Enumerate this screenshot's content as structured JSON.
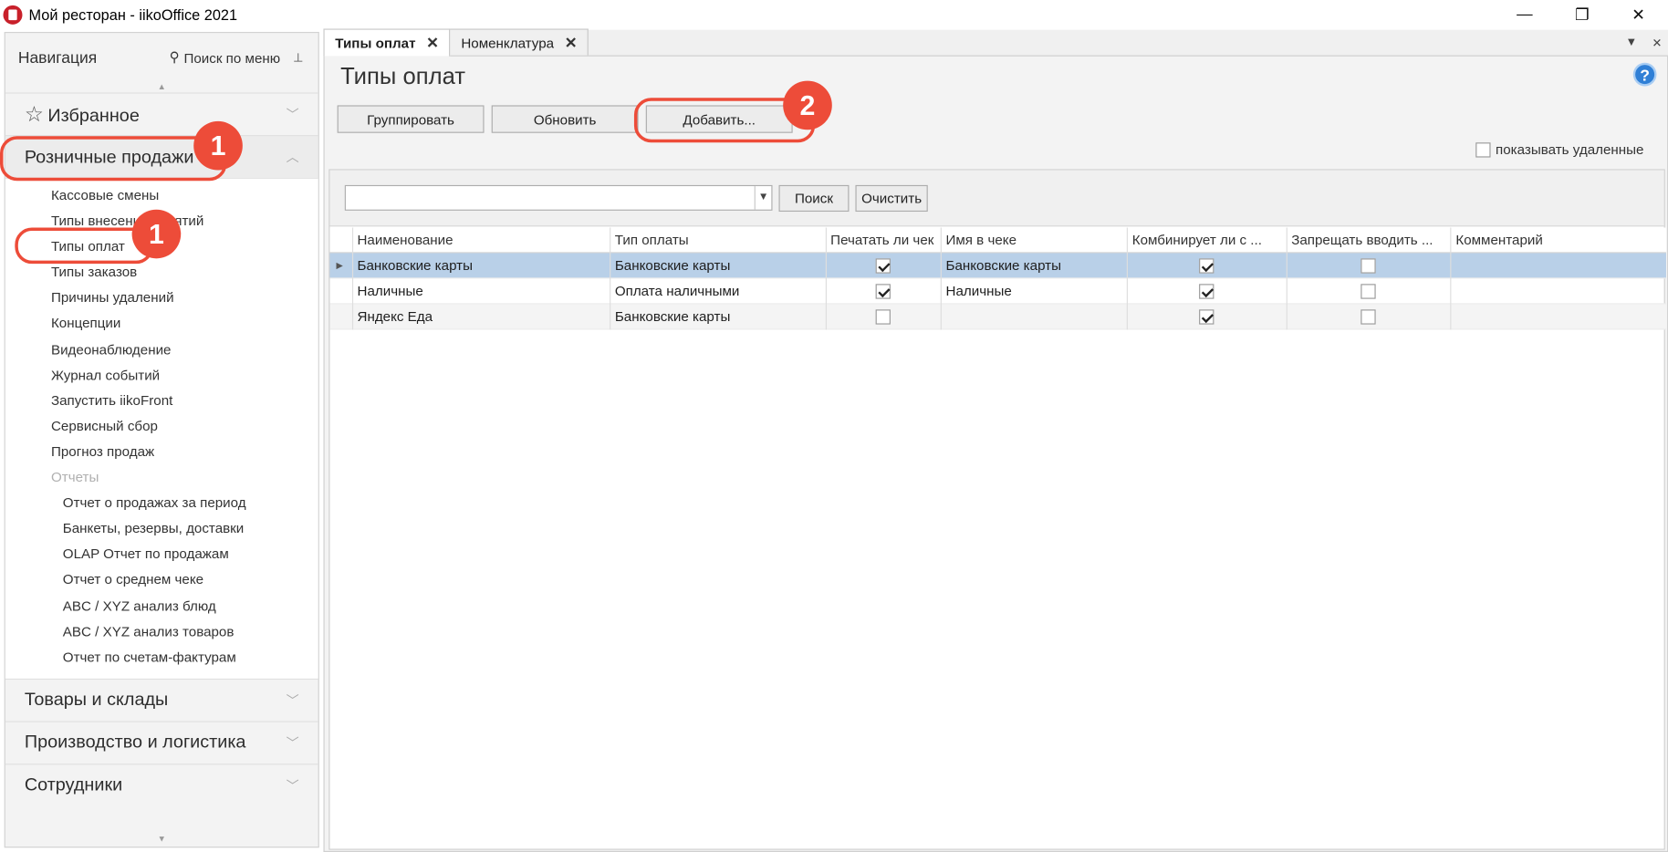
{
  "window": {
    "title": "Мой ресторан - iikoOffice 2021",
    "minimize": "—",
    "restore": "❐",
    "close": "✕"
  },
  "sidebar": {
    "header": "Навигация",
    "search_label": "Поиск по меню",
    "groups_top": [
      {
        "label": "Избранное"
      },
      {
        "label": "Розничные продажи"
      }
    ],
    "items": [
      "Кассовые смены",
      "Типы внесений/изъятий",
      "Типы оплат",
      "Типы заказов",
      "Причины удалений",
      "Концепции",
      "Видеонаблюдение",
      "Журнал событий",
      "Запустить iikoFront",
      "Сервисный сбор",
      "Прогноз продаж"
    ],
    "reports_label": "Отчеты",
    "reports": [
      "Отчет о продажах за период",
      "Банкеты, резервы, доставки",
      "OLAP Отчет по продажам",
      "Отчет о среднем чеке",
      "ABC / XYZ анализ блюд",
      "ABC / XYZ анализ товаров",
      "Отчет по счетам-фактурам"
    ],
    "groups_bottom": [
      {
        "label": "Товары и склады"
      },
      {
        "label": "Производство и логистика"
      },
      {
        "label": "Сотрудники"
      }
    ]
  },
  "tabs": [
    {
      "label": "Типы оплат",
      "active": true
    },
    {
      "label": "Номенклатура",
      "active": false
    }
  ],
  "page": {
    "title": "Типы оплат",
    "help": "?",
    "buttons": {
      "group": "Группировать",
      "refresh": "Обновить",
      "add": "Добавить..."
    },
    "show_deleted": "показывать удаленные",
    "filter": {
      "search": "Поиск",
      "clear": "Очистить",
      "value": ""
    }
  },
  "table": {
    "columns": [
      "Наименование",
      "Тип оплаты",
      "Печатать ли чек",
      "Имя в чеке",
      "Комбинирует ли с ...",
      "Запрещать вводить ...",
      "Комментарий"
    ],
    "rows": [
      {
        "name": "Банковские карты",
        "type": "Банковские карты",
        "print": true,
        "receipt_name": "Банковские карты",
        "combine": true,
        "forbid": false,
        "comment": ""
      },
      {
        "name": "Наличные",
        "type": "Оплата наличными",
        "print": true,
        "receipt_name": "Наличные",
        "combine": true,
        "forbid": false,
        "comment": ""
      },
      {
        "name": "Яндекс Еда",
        "type": "Банковские карты",
        "print": false,
        "receipt_name": "",
        "combine": true,
        "forbid": false,
        "comment": ""
      }
    ]
  },
  "annotations": [
    "1",
    "1",
    "2"
  ],
  "colors": {
    "accent": "#ed4c39",
    "selection": "#b9d0e8",
    "help": "#2f7fd6"
  }
}
